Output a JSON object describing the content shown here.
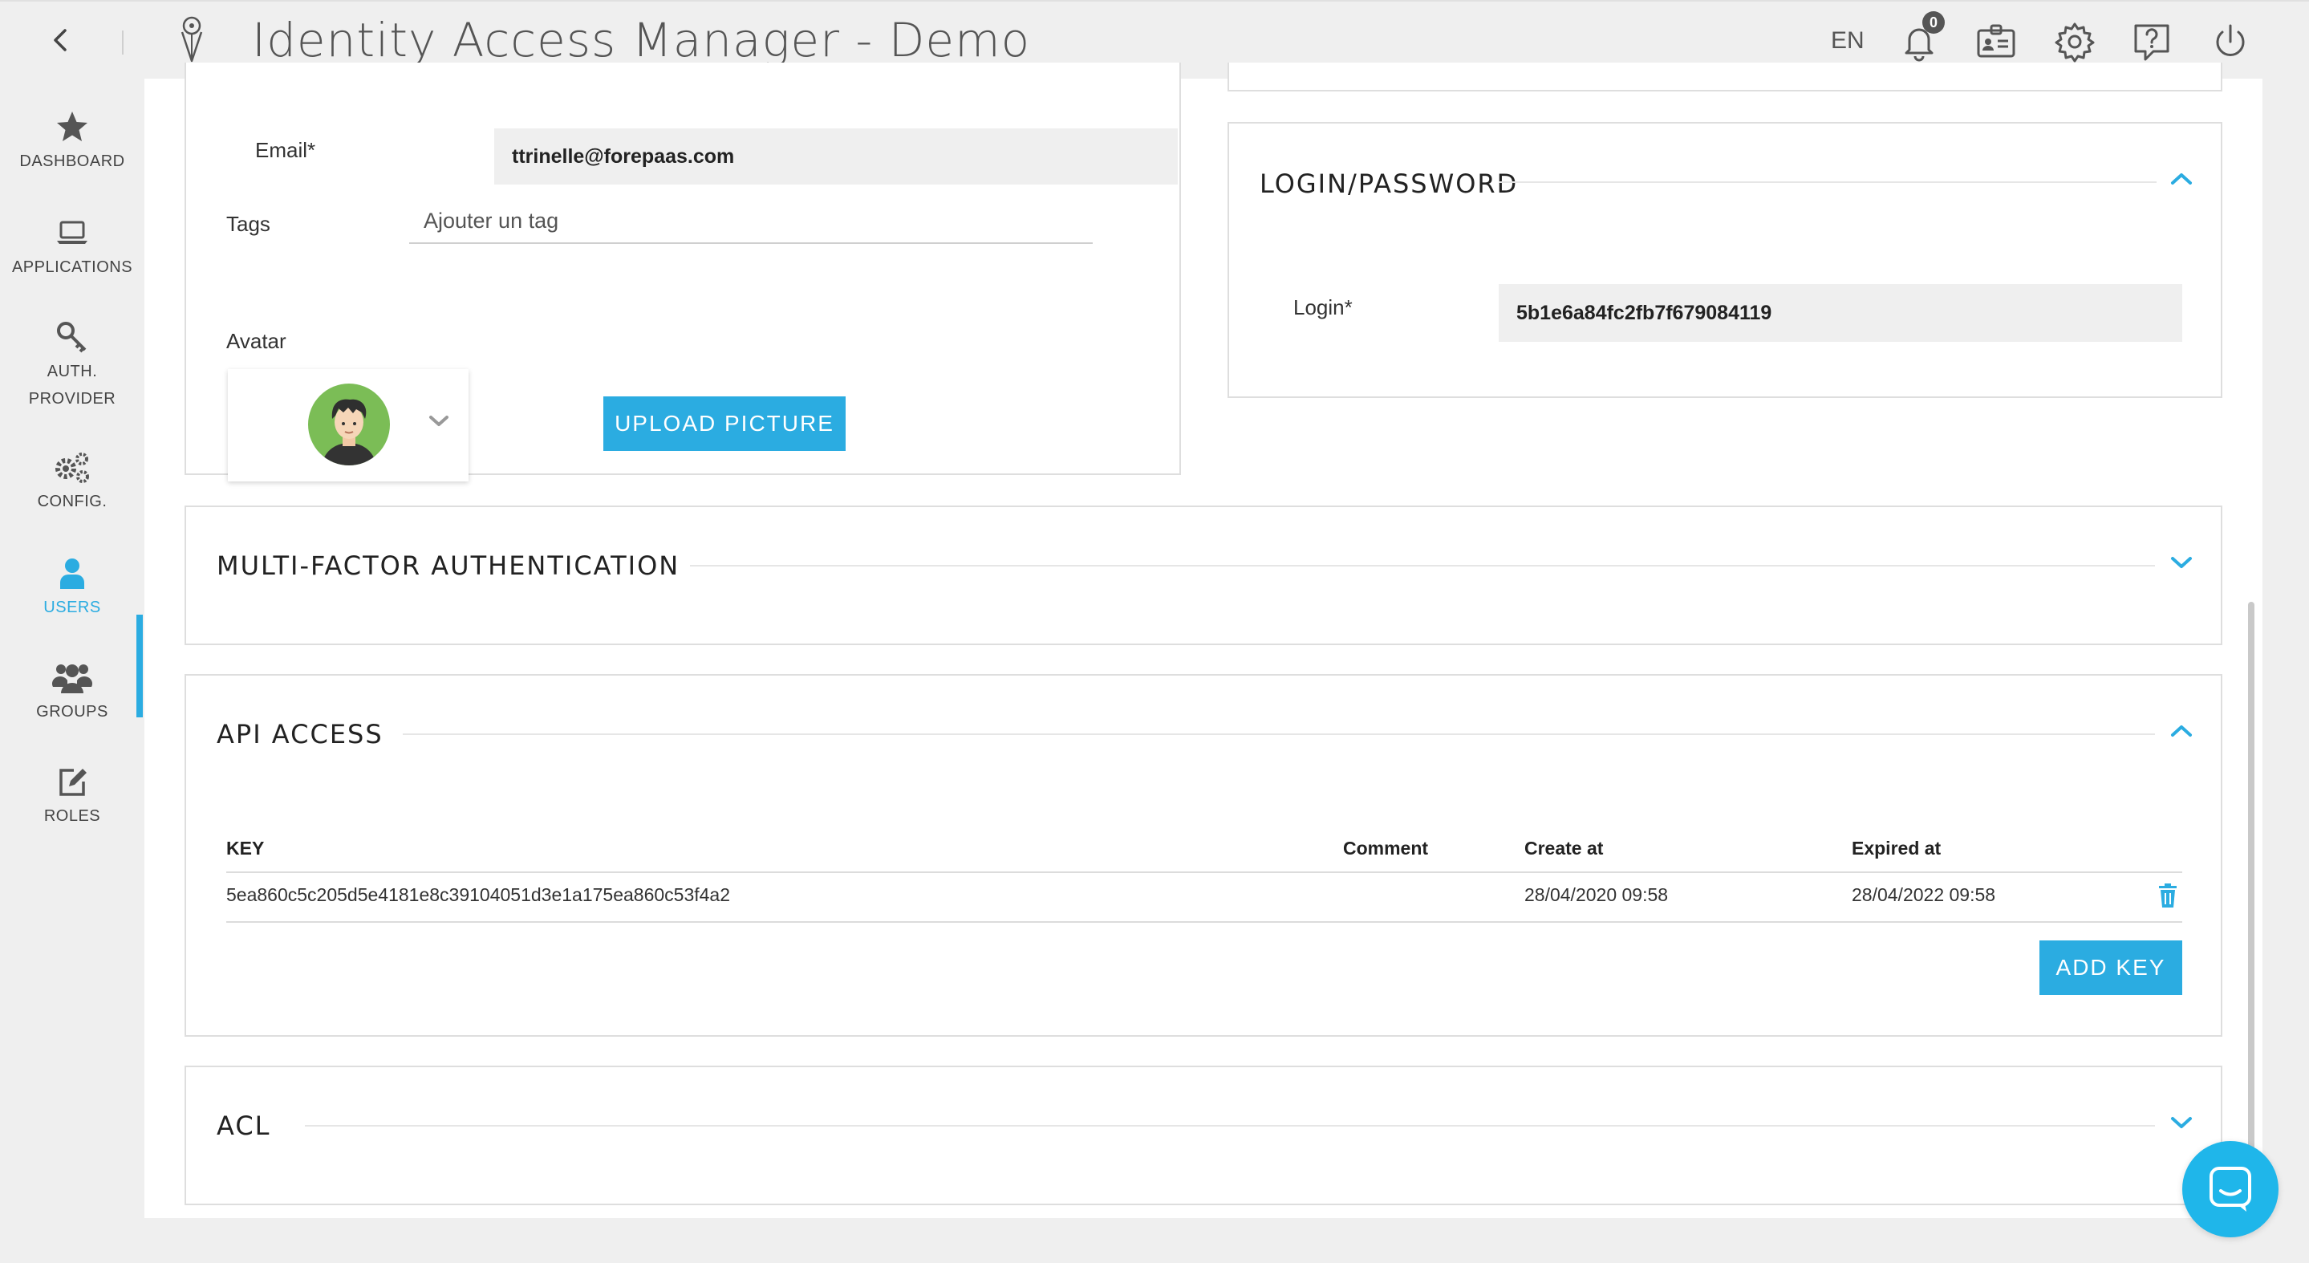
{
  "app": {
    "title": "Identity Access Manager - Demo"
  },
  "topbar": {
    "language": "EN",
    "notification_count": "0",
    "icons": [
      "back-arrow-icon",
      "logo-icon",
      "bell-icon",
      "id-card-icon",
      "gear-icon",
      "help-icon",
      "power-icon"
    ]
  },
  "sidebar": {
    "items": [
      {
        "label": "DASHBOARD",
        "icon": "star-icon"
      },
      {
        "label": "APPLICATIONS",
        "icon": "laptop-icon"
      },
      {
        "label": "AUTH.\nPROVIDER",
        "line1": "AUTH.",
        "line2": "PROVIDER",
        "icon": "key-icon"
      },
      {
        "label": "CONFIG.",
        "icon": "gears-icon"
      },
      {
        "label": "USERS",
        "icon": "user-icon",
        "active": true
      },
      {
        "label": "GROUPS",
        "icon": "group-icon"
      },
      {
        "label": "ROLES",
        "icon": "edit-icon"
      }
    ]
  },
  "profile": {
    "email_label": "Email*",
    "email_value": "ttrinelle@forepaas.com",
    "tags_label": "Tags",
    "tags_placeholder": "Ajouter un tag",
    "avatar_label": "Avatar",
    "upload_button": "UPLOAD PICTURE"
  },
  "login_section": {
    "title": "LOGIN/PASSWORD",
    "login_label": "Login*",
    "login_value": "5b1e6a84fc2fb7f679084119",
    "expanded": true
  },
  "mfa_section": {
    "title": "MULTI-FACTOR AUTHENTICATION",
    "expanded": false
  },
  "api_section": {
    "title": "API ACCESS",
    "expanded": true,
    "columns": [
      "KEY",
      "Comment",
      "Create at",
      "Expired at"
    ],
    "rows": [
      {
        "key": "5ea860c5c205d5e4181e8c39104051d3e1a175ea860c53f4a2",
        "comment": "",
        "created": "28/04/2020 09:58",
        "expires": "28/04/2022 09:58"
      }
    ],
    "add_button": "ADD KEY"
  },
  "acl_section": {
    "title": "ACL",
    "expanded": false
  },
  "colors": {
    "accent": "#2bace1",
    "chat": "#1fb6ea"
  }
}
